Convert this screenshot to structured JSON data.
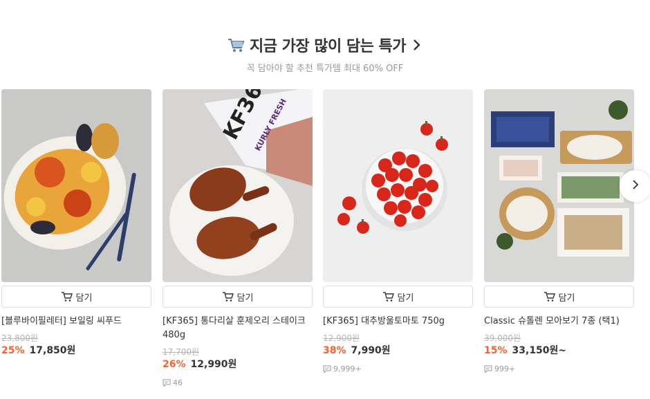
{
  "header": {
    "title": "지금 가장 많이 담는 특가",
    "subtitle": "꼭 담아야 할 추천 특가템 최대 60% OFF"
  },
  "cart_label": "담기",
  "products": [
    {
      "name": "[블루바이필레터] 보일링 씨푸드",
      "original_price": "23,800원",
      "discount": "25%",
      "price": "17,850원",
      "reviews": ""
    },
    {
      "name": "[KF365] 통다리살 훈제오리 스테이크 480g",
      "original_price": "17,700원",
      "discount": "26%",
      "price": "12,990원",
      "reviews": "46"
    },
    {
      "name": "[KF365] 대추방울토마토 750g",
      "original_price": "12,900원",
      "discount": "38%",
      "price": "7,990원",
      "reviews": "9,999+"
    },
    {
      "name": "Classic 슈톨렌 모아보기 7종 (택1)",
      "original_price": "39,000원",
      "discount": "15%",
      "price": "33,150원~",
      "reviews": "999+"
    }
  ],
  "image_text": {
    "brand_code": "KF365",
    "brand_sub": "KURLY FRESH"
  },
  "colors": {
    "discount": "#fa622f",
    "text": "#333333",
    "muted": "#999999"
  },
  "icons": [
    "cart-emoji-icon",
    "chevron-right-icon",
    "cart-icon",
    "comment-icon",
    "arrow-right-icon"
  ]
}
